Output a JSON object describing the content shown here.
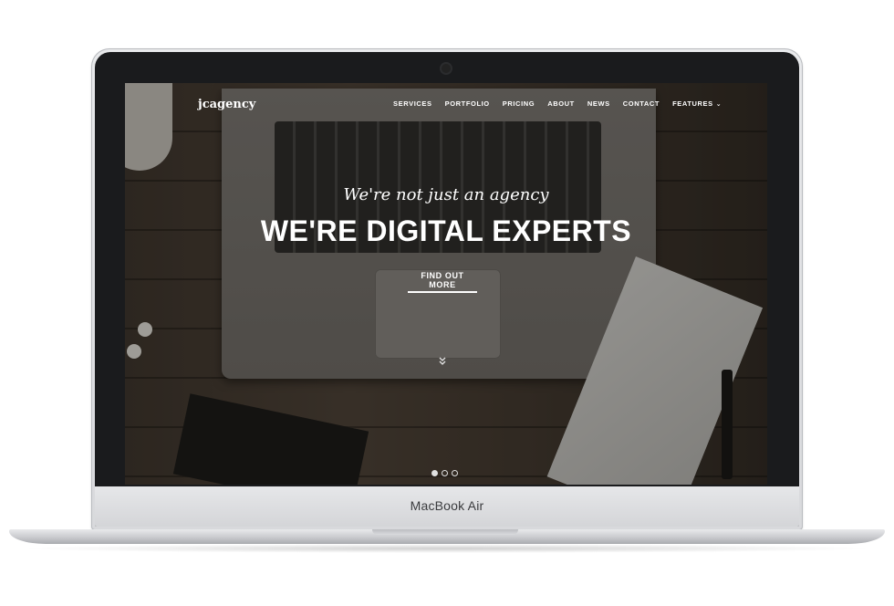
{
  "device": {
    "label": "MacBook Air"
  },
  "site": {
    "logo": "jcagency",
    "nav": [
      {
        "label": "SERVICES"
      },
      {
        "label": "PORTFOLIO"
      },
      {
        "label": "PRICING"
      },
      {
        "label": "ABOUT"
      },
      {
        "label": "NEWS"
      },
      {
        "label": "CONTACT"
      },
      {
        "label": "FEATURES",
        "has_dropdown": true
      }
    ]
  },
  "hero": {
    "tagline": "We're not just an agency",
    "headline": "WE'RE DIGITAL EXPERTS",
    "cta": "FIND OUT MORE",
    "scroll_icon": "double-chevron-down-icon",
    "slides": {
      "count": 3,
      "active": 1
    }
  }
}
